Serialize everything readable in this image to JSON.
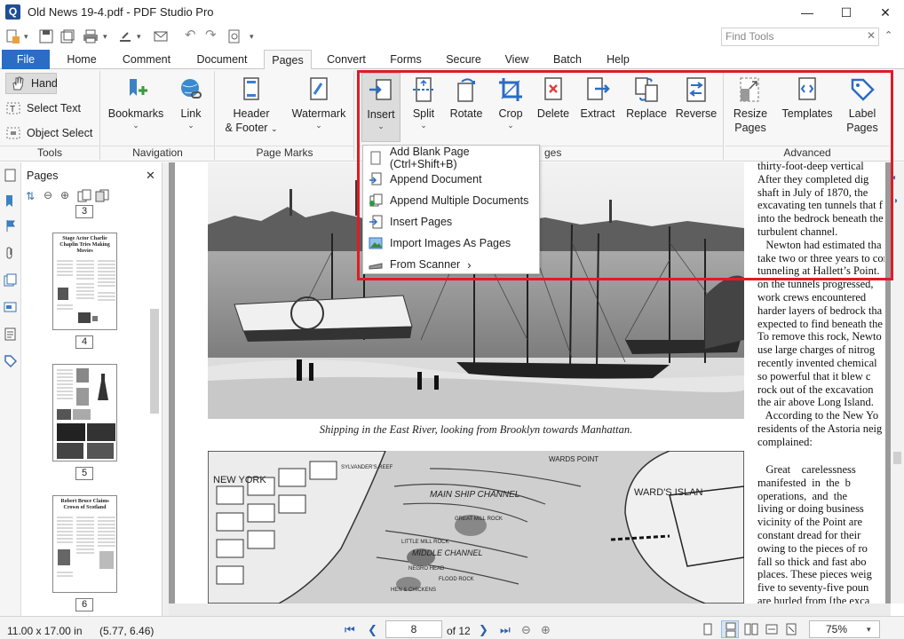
{
  "window": {
    "title": "Old News 19-4.pdf - PDF Studio Pro",
    "logo_letter": "Q",
    "minimize": "—",
    "maximize": "☐",
    "close": "✕"
  },
  "search": {
    "placeholder": "Find Tools",
    "clear": "✕",
    "collapse": "⌃"
  },
  "tabs": [
    "File",
    "Home",
    "Comment",
    "Document",
    "Pages",
    "Convert",
    "Forms",
    "Secure",
    "View",
    "Batch",
    "Help"
  ],
  "active_tab": "Pages",
  "ribbon": {
    "tools": {
      "hand": "Hand",
      "select_text": "Select Text",
      "object_select": "Object Select",
      "label": "Tools"
    },
    "navigation": {
      "bookmarks": "Bookmarks",
      "link": "Link",
      "label": "Navigation"
    },
    "page_marks": {
      "header_footer_1": "Header",
      "header_footer_2": "& Footer",
      "watermark": "Watermark",
      "label": "Page Marks"
    },
    "pages": {
      "insert": "Insert",
      "split": "Split",
      "rotate": "Rotate",
      "crop": "Crop",
      "delete": "Delete",
      "extract": "Extract",
      "replace": "Replace",
      "reverse": "Reverse",
      "label_partial": "ges"
    },
    "advanced": {
      "resize_1": "Resize",
      "resize_2": "Pages",
      "templates": "Templates",
      "label_1": "Label",
      "label_2": "Pages",
      "label": "Advanced"
    }
  },
  "insert_menu": [
    {
      "label": "Add Blank Page  (Ctrl+Shift+B)",
      "icon": "blank-page-icon"
    },
    {
      "label": "Append Document",
      "icon": "append-document-icon"
    },
    {
      "label": "Append Multiple Documents",
      "icon": "append-multiple-icon"
    },
    {
      "label": "Insert Pages",
      "icon": "insert-pages-icon"
    },
    {
      "label": "Import Images As Pages",
      "icon": "import-images-icon"
    },
    {
      "label": "From Scanner",
      "icon": "scanner-icon",
      "submenu": "›"
    }
  ],
  "pages_panel": {
    "title": "Pages",
    "close": "✕",
    "page_numbers": [
      "3",
      "4",
      "5",
      "6"
    ],
    "thumb_titles": {
      "p4": "Stage Actor Charlie Chaplin Tries Making Movies",
      "p6": "Robert Bruce Claims Crown of Scotland"
    }
  },
  "document": {
    "caption": "Shipping in the East River, looking from Brooklyn towards Manhattan.",
    "column_lines_1": [
      "thirty-foot-deep vertical",
      "After they completed dig",
      "shaft in July of 1870, the",
      "excavating ten tunnels that f",
      "into the bedrock beneath the",
      "turbulent channel.",
      "   Newton had estimated tha",
      "take two or three years to com",
      "tunneling at Hallett’s Point.",
      "on the tunnels progressed,",
      "work crews encountered",
      "harder layers of bedrock tha",
      "expected to find beneath the",
      "To remove this rock, Newto",
      "use large charges of nitrog",
      "recently invented chemical",
      "so powerful that it blew c",
      "rock out of the excavation",
      "the air above Long Island.",
      "   According to the New Yo",
      "residents of the Astoria neig",
      "complained:"
    ],
    "column_lines_2": [
      "   Great    carelessness",
      "manifested  in  the  b",
      "operations,  and  the",
      "living or doing business",
      "vicinity of the Point are",
      "constant dread for their",
      "owing to the pieces of ro",
      "fall so thick and fast abo",
      "places. These pieces weig",
      "five to seventy-five poun",
      "are hurled from [the exca"
    ],
    "map_labels": [
      "NEW YORK",
      "WARDS POINT",
      "MAIN SHIP CHANNEL",
      "WARD'S ISLAN",
      "MIDDLE CHANNEL",
      "GREAT MILL ROCK",
      "LITTLE MILL ROCK",
      "HEN & CHICKENS",
      "NEGRO HEAD",
      "FLOOD ROCK",
      "SYLVANDER'S REEF"
    ]
  },
  "status": {
    "page_size": "11.00 x 17.00 in",
    "coords": "(5.77, 6.46)",
    "current_page": "8",
    "of_pages": "of 12",
    "zoom": "75%"
  },
  "colors": {
    "accent": "#2b6cc4",
    "highlight": "#e01b24"
  }
}
